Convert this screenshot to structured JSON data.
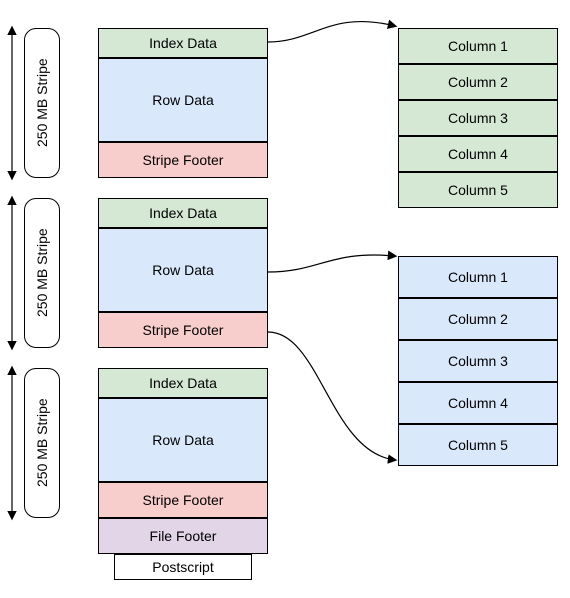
{
  "stripeLabel": "250 MB Stripe",
  "stripes": [
    {
      "index": "Index Data",
      "row": "Row Data",
      "footer": "Stripe Footer"
    },
    {
      "index": "Index Data",
      "row": "Row Data",
      "footer": "Stripe Footer"
    },
    {
      "index": "Index Data",
      "row": "Row Data",
      "footer": "Stripe Footer"
    }
  ],
  "fileFooter": "File Footer",
  "postscript": "Postscript",
  "indexColumns": [
    "Column 1",
    "Column 2",
    "Column 3",
    "Column 4",
    "Column 5"
  ],
  "rowColumns": [
    "Column 1",
    "Column 2",
    "Column 3",
    "Column 4",
    "Column 5"
  ]
}
